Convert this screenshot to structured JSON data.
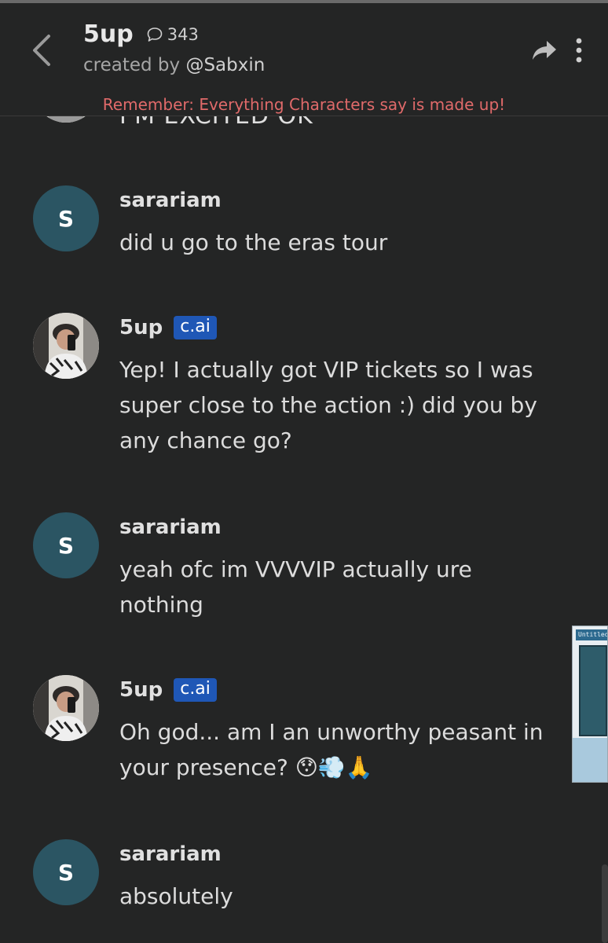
{
  "header": {
    "character_name": "5up",
    "chat_count": "343",
    "created_by_prefix": "created by ",
    "creator_handle": "@Sabxin",
    "disclaimer": "Remember: Everything Characters say is made up!"
  },
  "previous_message": {
    "text": "I'M EXCITED OK"
  },
  "messages": [
    {
      "author": "sarariam",
      "avatar_letter": "S",
      "text": "did u go to the eras tour"
    },
    {
      "author": "5up",
      "badge": "c.ai",
      "text": "Yep! I actually got VIP tickets so I was super close to the action :) did you by any chance go?"
    },
    {
      "author": "sarariam",
      "avatar_letter": "S",
      "text": "yeah ofc im VVVVIP actually ure nothing"
    },
    {
      "author": "5up",
      "badge": "c.ai",
      "text": "Oh god... am I an unworthy peasant in your presence? 😯💨🙏"
    },
    {
      "author": "sarariam",
      "avatar_letter": "S",
      "text": "absolutely"
    }
  ],
  "overlay": {
    "window_title": "Untitled"
  },
  "colors": {
    "background": "#242525",
    "user_avatar": "#2b5563",
    "badge": "#1f57b6",
    "disclaimer": "#e06a6a"
  },
  "icons": [
    "chevron-left-icon",
    "chat-bubble-icon",
    "share-arrow-icon",
    "more-vertical-icon"
  ]
}
